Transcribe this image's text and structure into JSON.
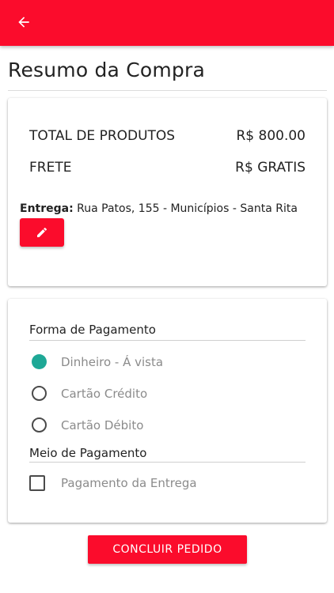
{
  "appbar": {
    "color": "#fb0c2c",
    "back_icon": "arrow-back-icon"
  },
  "page_title": "Resumo da Compra",
  "summary": {
    "total_label": "TOTAL DE PRODUTOS",
    "total_value": "R$ 800.00",
    "freight_label": "FRETE",
    "freight_value": "R$ GRATIS",
    "delivery_label": "Entrega:",
    "delivery_address": " Rua Patos, 155 - Municípios - Santa Rita",
    "edit_icon": "pencil-icon"
  },
  "payment": {
    "form_title": "Forma de Pagamento",
    "options": [
      {
        "label": "Dinheiro - Á vista",
        "selected": true
      },
      {
        "label": "Cartão Crédito",
        "selected": false
      },
      {
        "label": "Cartão Débito",
        "selected": false
      }
    ],
    "means_title": "Meio de Pagamento",
    "means_option": {
      "label": "Pagamento da Entrega",
      "checked": false
    },
    "selected_color": "#1ea896"
  },
  "conclude_label": "CONCLUIR PEDIDO"
}
